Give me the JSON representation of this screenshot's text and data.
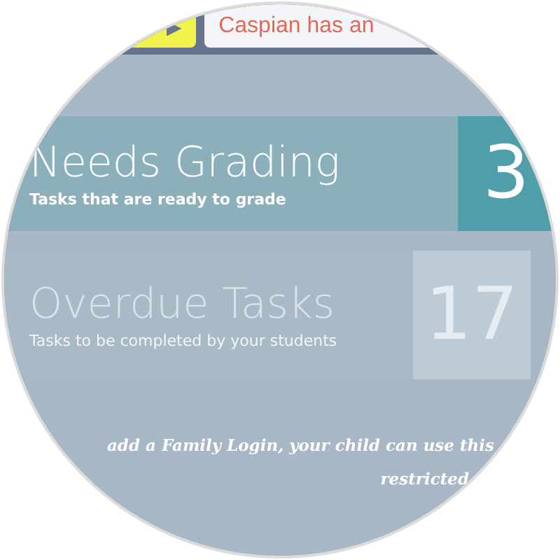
{
  "top_bar": {
    "button_icon": "▶",
    "notification": "Caspian has an"
  },
  "panels": [
    {
      "kind": "primary",
      "title": "Needs Grading",
      "subtitle": "Tasks that are ready to grade",
      "count": "3"
    },
    {
      "kind": "muted",
      "title": "Overdue Tasks",
      "subtitle": "Tasks to be completed by your students",
      "count": "17"
    }
  ],
  "footer_lines": [
    "add a Family Login, your child can use this",
    "restricted"
  ]
}
